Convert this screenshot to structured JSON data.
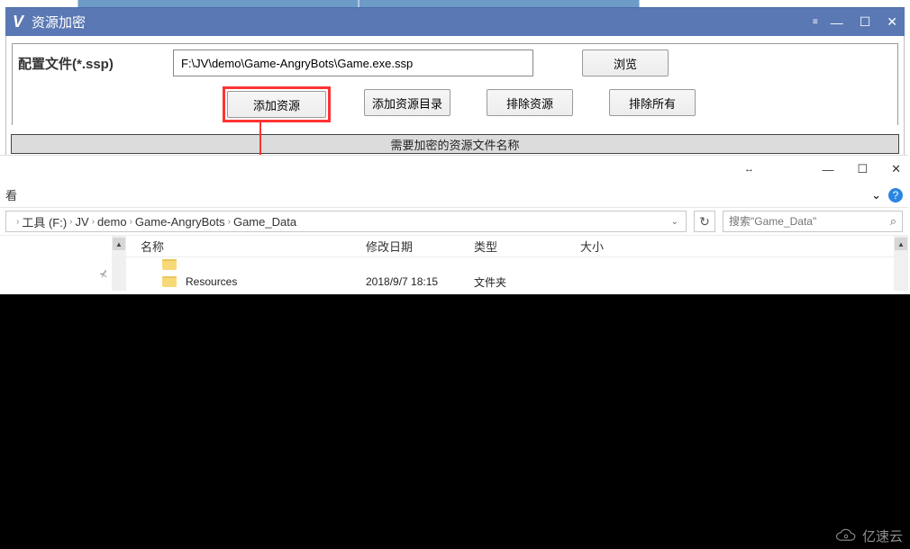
{
  "app": {
    "logo": "V",
    "title": "资源加密",
    "controls": {
      "menu": "≡",
      "min": "—",
      "max": "☐",
      "close": "✕"
    }
  },
  "config": {
    "label": "配置文件(*.ssp)",
    "path": "F:\\JV\\demo\\Game-AngryBots\\Game.exe.ssp",
    "browse": "浏览"
  },
  "buttons": {
    "add_resource": "添加资源",
    "add_resource_dir": "添加资源目录",
    "exclude_resource": "排除资源",
    "exclude_all": "排除所有"
  },
  "section_header": "需要加密的资源文件名称",
  "explorer": {
    "win_controls": {
      "drag": "↔",
      "min": "—",
      "max": "☐",
      "close": "✕"
    },
    "menu_left": "看",
    "chevron": "⌄",
    "help": "?",
    "breadcrumbs": [
      "工具 (F:)",
      "JV",
      "demo",
      "Game-AngryBots",
      "Game_Data"
    ],
    "refresh": "↻",
    "search_placeholder": "搜索\"Game_Data\"",
    "columns": {
      "name": "名称",
      "date": "修改日期",
      "type": "类型",
      "size": "大小"
    },
    "rows": [
      {
        "name": "Resources",
        "date": "2018/9/7 18:15",
        "type": "文件夹",
        "size": ""
      }
    ],
    "scroll_up": "▲",
    "pin": "⊀"
  },
  "watermark": "亿速云"
}
